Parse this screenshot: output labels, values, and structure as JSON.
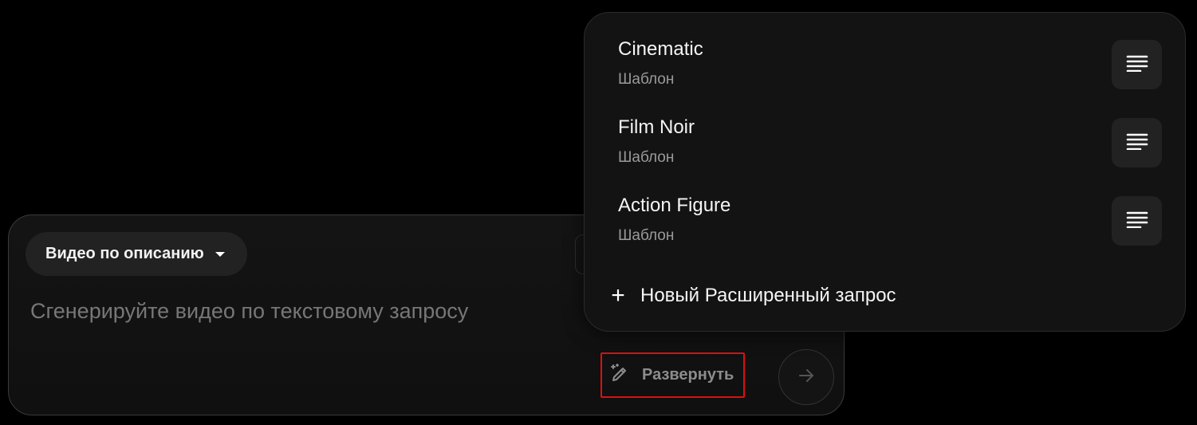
{
  "prompt_panel": {
    "mode_dropdown_label": "Видео по описанию",
    "input_placeholder": "Сгенерируйте видео по текстовому запросу",
    "input_value": "",
    "expand_button_label": "Развернуть"
  },
  "templates_menu": {
    "items": [
      {
        "title": "Cinematic",
        "subtitle": "Шаблон"
      },
      {
        "title": "Film Noir",
        "subtitle": "Шаблон"
      },
      {
        "title": "Action Figure",
        "subtitle": "Шаблон"
      }
    ],
    "new_prompt_label": "Новый Расширенный запрос"
  },
  "icons": {
    "dropdown": "caret-down-icon",
    "expand": "magic-pen-icon",
    "send": "arrow-right-icon",
    "template_detail": "lines-icon",
    "new_prompt": "plus-icon"
  },
  "colors": {
    "background": "#000000",
    "panel": "#141414",
    "menu": "#131313",
    "highlight_border": "#e00f0f",
    "muted_text": "#9a9a9a"
  }
}
